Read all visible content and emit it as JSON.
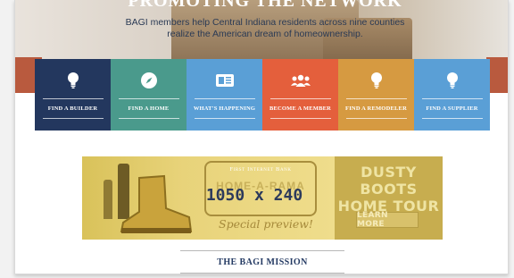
{
  "hero": {
    "title": "PROMOTING THE NETWORK",
    "intro": "BAGI members help Central Indiana residents across nine counties realize the American dream of homeownership."
  },
  "tiles": [
    {
      "label": "FIND A BUILDER",
      "color": "#23375e",
      "icon": "lightbulb-icon"
    },
    {
      "label": "FIND A HOME",
      "color": "#4a9a8c",
      "icon": "compass-icon"
    },
    {
      "label": "WHAT'S HAPPENING",
      "color": "#5a9fd6",
      "icon": "newspaper-icon"
    },
    {
      "label": "BECOME A MEMBER",
      "color": "#e45f3c",
      "icon": "group-icon"
    },
    {
      "label": "FIND A REMODELER",
      "color": "#d69a41",
      "icon": "lightbulb-icon"
    },
    {
      "label": "FIND A SUPPLIER",
      "color": "#5a9fd6",
      "icon": "lightbulb-icon"
    }
  ],
  "banner": {
    "bank": "First Internet Bank",
    "home_a_rama": "HOME-A-RAMA",
    "dimensions": "1050 x 240",
    "special": "Special preview!",
    "dusty_line1": "DUSTY BOOTS",
    "dusty_line2": "HOME TOUR",
    "cta": "LEARN MORE"
  },
  "mission": {
    "heading": "THE BAGI MISSION"
  }
}
